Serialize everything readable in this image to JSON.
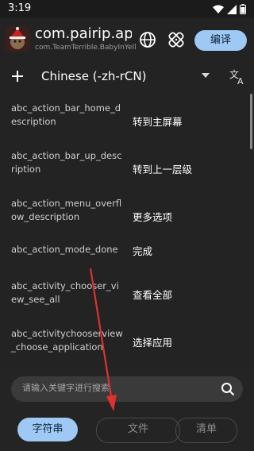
{
  "status_bar": {
    "time": "3:19"
  },
  "header": {
    "package_name": "com.pairip.ap...",
    "package_id": "com.TeamTerrible.BabyInYell...",
    "translate_button": "编译"
  },
  "language": {
    "selected": "Chinese (-zh-rCN)"
  },
  "strings": [
    {
      "key": "abc_action_bar_home_description",
      "value": "转到主屏幕"
    },
    {
      "key": "abc_action_bar_up_description",
      "value": "转到上一层级"
    },
    {
      "key": "abc_action_menu_overflow_description",
      "value": "更多选项"
    },
    {
      "key": "abc_action_mode_done",
      "value": "完成"
    },
    {
      "key": "abc_activity_chooser_view_see_all",
      "value": "查看全部"
    },
    {
      "key": "abc_activitychooserview_choose_application",
      "value": "选择应用"
    }
  ],
  "search": {
    "placeholder": "请输入关键字进行搜索",
    "value": ""
  },
  "tabs": [
    {
      "label": "字符串"
    },
    {
      "label": "文件"
    },
    {
      "label": "清单"
    }
  ],
  "colors": {
    "accent": "#9ec9f5",
    "background": "#232323",
    "annotation": "#e0312e"
  }
}
